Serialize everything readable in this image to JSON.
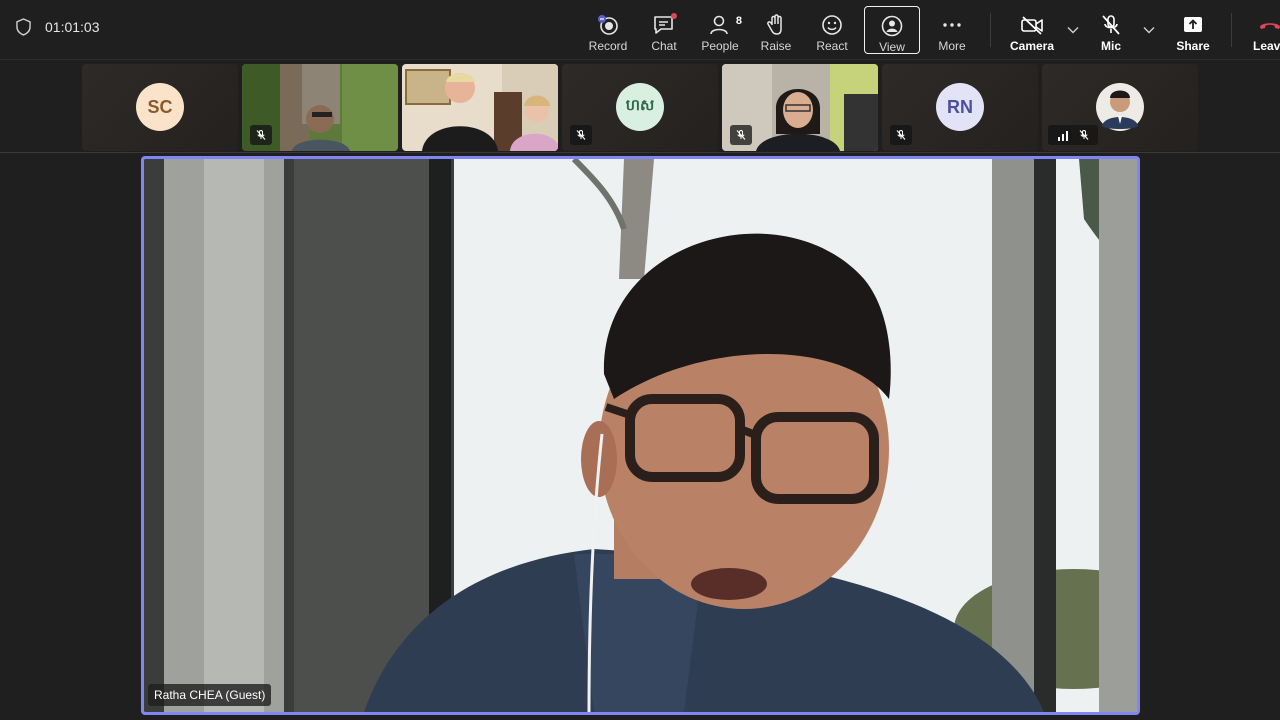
{
  "meeting": {
    "elapsed": "01:01:03"
  },
  "toolbar": {
    "record": "Record",
    "chat": "Chat",
    "people": "People",
    "people_count": "8",
    "raise": "Raise",
    "react": "React",
    "view": "View",
    "more": "More",
    "camera": "Camera",
    "mic": "Mic",
    "share": "Share",
    "leave": "Leave"
  },
  "participants": [
    {
      "initials": "SC",
      "type": "avatar",
      "bg": "#fbe3c9",
      "fg": "#8a5a2b",
      "muted": false
    },
    {
      "type": "video",
      "muted": true
    },
    {
      "type": "video",
      "muted": false
    },
    {
      "initials": "ហស",
      "type": "avatar",
      "bg": "#d9efe0",
      "fg": "#2f6b47",
      "muted": true
    },
    {
      "type": "video",
      "muted": true
    },
    {
      "initials": "RN",
      "type": "avatar",
      "bg": "#e2e3f7",
      "fg": "#4b4f9c",
      "muted": true
    },
    {
      "type": "photo",
      "muted": true,
      "signal": true
    }
  ],
  "speaker": {
    "name": "Ratha CHEA (Guest)"
  },
  "colors": {
    "active_border": "#7f85f5",
    "leave_red": "#e0465a",
    "background": "#1f1f1f"
  }
}
